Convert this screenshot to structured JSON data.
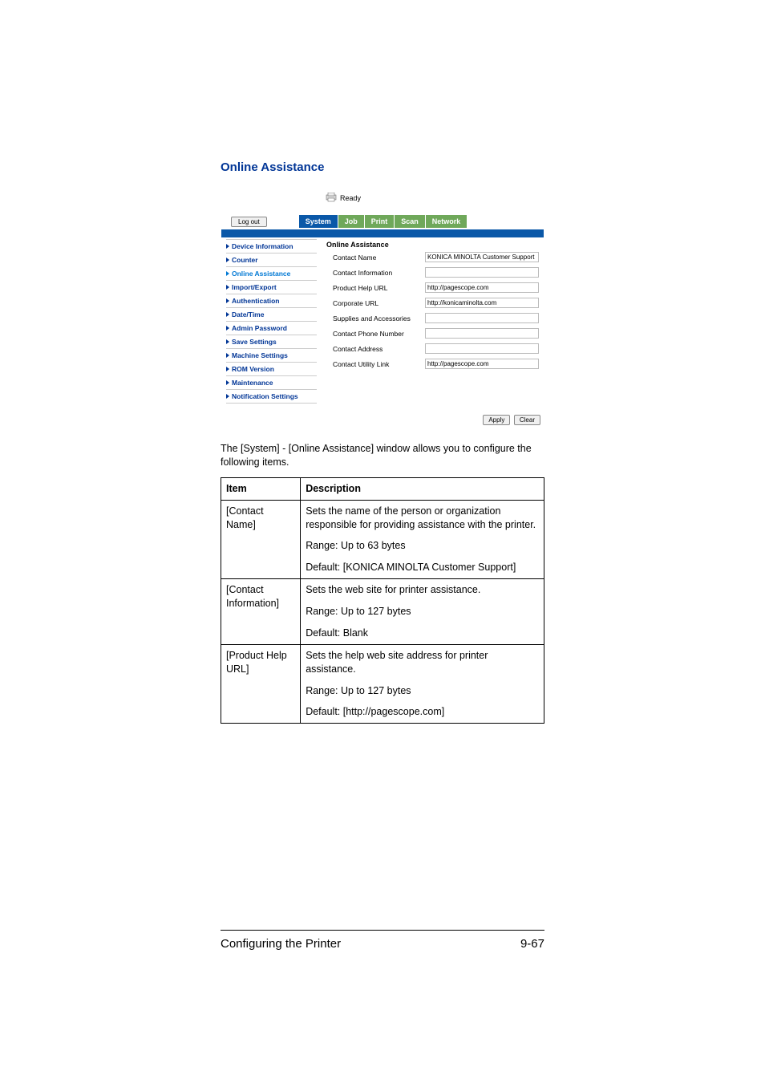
{
  "section_title": "Online Assistance",
  "status_text": "Ready",
  "logout_label": "Log out",
  "tabs": {
    "system": "System",
    "job": "Job",
    "print": "Print",
    "scan": "Scan",
    "network": "Network"
  },
  "menu": {
    "device_information": "Device Information",
    "counter": "Counter",
    "online_assistance": "Online Assistance",
    "import_export": "Import/Export",
    "authentication": "Authentication",
    "date_time": "Date/Time",
    "admin_password": "Admin Password",
    "save_settings": "Save Settings",
    "machine_settings": "Machine Settings",
    "rom_version": "ROM Version",
    "maintenance": "Maintenance",
    "notification_settings": "Notification Settings"
  },
  "panel_title": "Online Assistance",
  "form": {
    "contact_name": {
      "label": "Contact Name",
      "value": "KONICA MINOLTA Customer Support"
    },
    "contact_information": {
      "label": "Contact Information",
      "value": ""
    },
    "product_help_url": {
      "label": "Product Help URL",
      "value": "http://pagescope.com"
    },
    "corporate_url": {
      "label": "Corporate URL",
      "value": "http://konicaminolta.com"
    },
    "supplies_accessories": {
      "label": "Supplies and Accessories",
      "value": ""
    },
    "contact_phone": {
      "label": "Contact Phone Number",
      "value": ""
    },
    "contact_address": {
      "label": "Contact Address",
      "value": ""
    },
    "contact_utility_link": {
      "label": "Contact Utility Link",
      "value": "http://pagescope.com"
    }
  },
  "buttons": {
    "apply": "Apply",
    "clear": "Clear"
  },
  "body_text": "The [System] - [Online Assistance] window allows you to configure the following items.",
  "table": {
    "header": {
      "item": "Item",
      "description": "Description"
    },
    "rows": {
      "contact_name": {
        "item": "[Contact Name]",
        "desc": "Sets the name of the person or organization responsible for providing assistance with the printer.",
        "range": "Range:   Up to 63 bytes",
        "default": "Default:  [KONICA MINOLTA Customer Support]"
      },
      "contact_information": {
        "item": "[Contact Information]",
        "desc": "Sets the web site for printer assistance.",
        "range": "Range:   Up to 127 bytes",
        "default": "Default:  Blank"
      },
      "product_help_url": {
        "item": "[Product Help URL]",
        "desc": "Sets the help web site address for printer assistance.",
        "range": "Range:   Up to 127 bytes",
        "default": "Default:  [http://pagescope.com]"
      }
    }
  },
  "footer": {
    "left": "Configuring the Printer",
    "right": "9-67"
  }
}
